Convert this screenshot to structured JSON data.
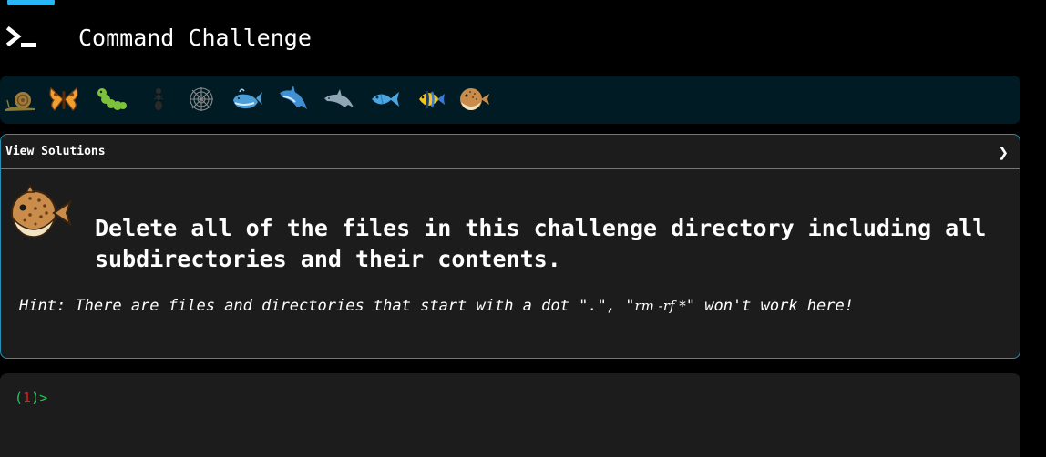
{
  "header": {
    "title": "Command Challenge",
    "logo_icon": "terminal-prompt-icon",
    "accent_color": "#29b6f6"
  },
  "levels": [
    {
      "icon": "snail-icon"
    },
    {
      "icon": "butterfly-icon"
    },
    {
      "icon": "caterpillar-icon"
    },
    {
      "icon": "ant-icon"
    },
    {
      "icon": "spider-web-icon"
    },
    {
      "icon": "whale-icon"
    },
    {
      "icon": "dolphin-blue-icon"
    },
    {
      "icon": "dolphin-grey-icon"
    },
    {
      "icon": "fish-icon"
    },
    {
      "icon": "tropical-fish-icon"
    },
    {
      "icon": "pufferfish-icon"
    }
  ],
  "challenge": {
    "view_solutions_label": "View Solutions",
    "toggle_glyph": "❯",
    "text": "Delete all of the files in this challenge directory including all subdirectories and their contents.",
    "hint_before": "Hint: There are files and directories that start with a dot \".\", \"",
    "hint_cmd": "rm -rf *",
    "hint_after": "\" won't work here!",
    "level_icon": "pufferfish-icon"
  },
  "terminal": {
    "prompt_open": "(",
    "prompt_number": "1",
    "prompt_close": ")>"
  },
  "colors": {
    "background": "#000000",
    "level_bar": "#001b23",
    "card": "#1c1c1c",
    "card_border": "#2a8fb0",
    "prompt_green": "#22c55e",
    "prompt_red": "#e01e1e"
  }
}
